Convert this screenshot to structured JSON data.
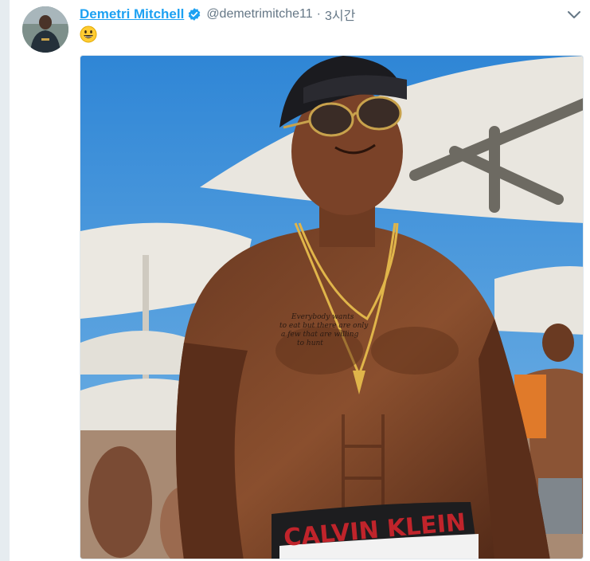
{
  "tweet": {
    "display_name": "Demetri Mitchell",
    "handle": "@demetrimitche11",
    "separator": "·",
    "time": "3시간",
    "body_emoji": "smiley-emoji",
    "verified_badge": "verified-badge-icon",
    "menu": "chevron-down-icon",
    "accent_color": "#1da1f2",
    "meta_color": "#657786",
    "media": {
      "waistband_text": "CALVIN KLEIN",
      "tattoo_text": "Everybody wants to eat but there are only a few that are willing to hunt"
    }
  }
}
